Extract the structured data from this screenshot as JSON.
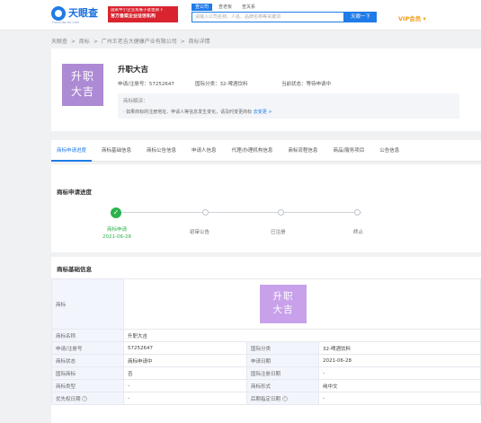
{
  "header": {
    "logo_text": "天眼查",
    "logo_sub": "TIANYANCHA.COM",
    "ad_line1": "国家中小企业发展子基金旗下",
    "ad_line2": "官方备案企业征信机构",
    "search_tabs": [
      "查公司",
      "查老板",
      "查关系"
    ],
    "search_placeholder": "请输入公司名称、人名、品牌名称等关键词",
    "search_button": "天眼一下",
    "vip_label": "VIP会员 ▾"
  },
  "breadcrumb": {
    "items": [
      "天眼查",
      "商标",
      "广州王老吉大健康产业有限公司",
      "商标详情"
    ],
    "separator": ">"
  },
  "trademark": {
    "logo_line1": "升职",
    "logo_line2": "大吉",
    "name": "升职大吉",
    "reg_no": "申请/注册号：57252647",
    "intl_class": "国际分类：32-啤酒饮料",
    "status": "当前状态：等待申请中",
    "interp_title": "商标解读：",
    "interp_text": "· 如果商标的注册地址、申请人等信息发生变化，请及时变更商标",
    "interp_link": "去变更 >"
  },
  "tabs": [
    "商标申请进度",
    "商标基础信息",
    "商标公告信息",
    "申请人信息",
    "代理/办理机构信息",
    "商标流程信息",
    "商品/服务项目",
    "公告信息"
  ],
  "progress": {
    "title": "商标申请进度",
    "steps": [
      {
        "label": "商标申请",
        "date": "2021-06-28",
        "done": true
      },
      {
        "label": "初审公告",
        "date": "",
        "done": false
      },
      {
        "label": "已注册",
        "date": "",
        "done": false
      },
      {
        "label": "终止",
        "date": "",
        "done": false
      }
    ]
  },
  "basic": {
    "title": "商标基础信息",
    "rows": [
      {
        "k1": "商标",
        "v1": "",
        "k2": "",
        "v2": ""
      },
      {
        "k1": "商标名称",
        "v1": "升职大吉",
        "k2": "",
        "v2": ""
      },
      {
        "k1": "申请/注册号",
        "v1": "57252647",
        "k2": "国际分类",
        "v2": "32-啤酒饮料"
      },
      {
        "k1": "商标状态",
        "v1": "商标申请中",
        "k2": "申请日期",
        "v2": "2021-06-28"
      },
      {
        "k1": "国际商标",
        "v1": "否",
        "k2": "国际注册日期",
        "v2": "-"
      },
      {
        "k1": "商标类型",
        "v1": "-",
        "k2": "商标形式",
        "v2": "纯中文"
      },
      {
        "k1": "优先权日期",
        "v1": "-",
        "k2": "后期指定日期",
        "v2": "-"
      }
    ]
  }
}
